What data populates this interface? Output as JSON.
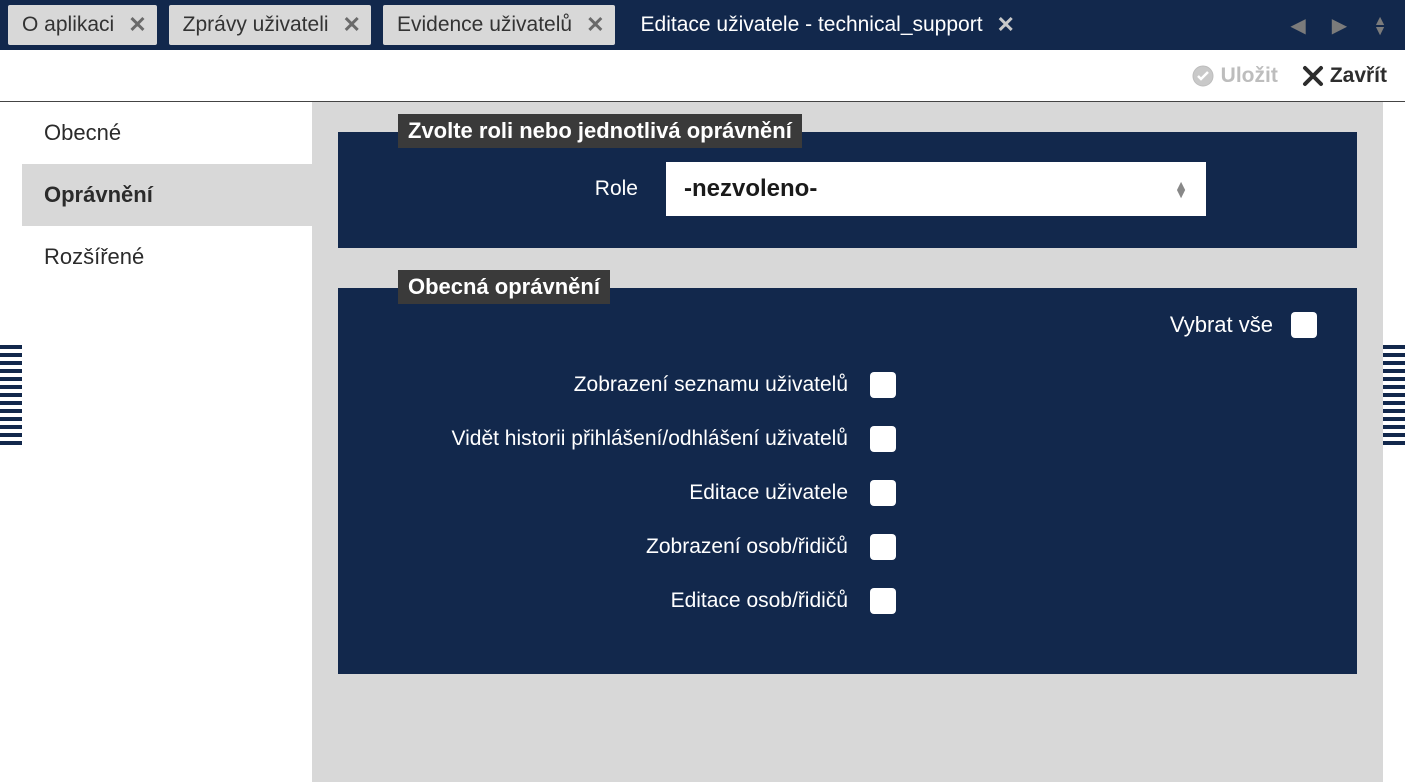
{
  "tabs": [
    {
      "label": "O aplikaci",
      "active": false
    },
    {
      "label": "Zprávy uživateli",
      "active": false
    },
    {
      "label": "Evidence uživatelů",
      "active": false
    },
    {
      "label": "Editace uživatele - technical_support",
      "active": true
    }
  ],
  "toolbar": {
    "save_label": "Uložit",
    "close_label": "Zavřít"
  },
  "sidebar": {
    "items": [
      {
        "label": "Obecné",
        "selected": false
      },
      {
        "label": "Oprávnění",
        "selected": true
      },
      {
        "label": "Rozšířené",
        "selected": false
      }
    ]
  },
  "rolePanel": {
    "title": "Zvolte roli nebo jednotlivá oprávnění",
    "role_label": "Role",
    "role_value": "-nezvoleno-"
  },
  "permPanel": {
    "title": "Obecná oprávnění",
    "select_all_label": "Vybrat vše",
    "items": [
      {
        "label": "Zobrazení seznamu uživatelů",
        "checked": false
      },
      {
        "label": "Vidět historii přihlášení/odhlášení uživatelů",
        "checked": false
      },
      {
        "label": "Editace uživatele",
        "checked": false
      },
      {
        "label": "Zobrazení osob/řidičů",
        "checked": false
      },
      {
        "label": "Editace osob/řidičů",
        "checked": false
      }
    ]
  }
}
